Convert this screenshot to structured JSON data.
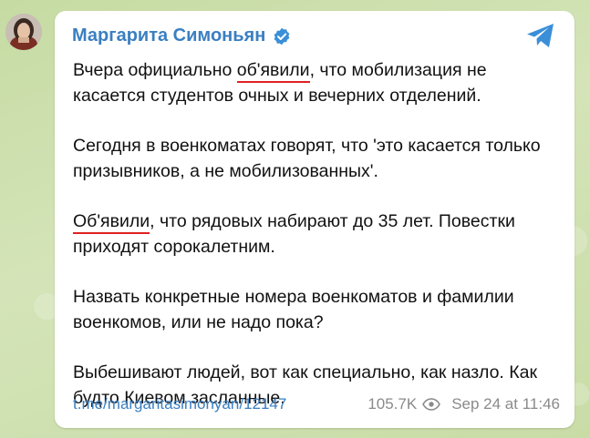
{
  "post": {
    "author": "Маргарита Симоньян",
    "paragraphs": [
      {
        "before": "Вчера официально ",
        "underlined": "об'явили",
        "after": ", что мобилизация не касается студентов очных и вечерних отделений."
      },
      {
        "text": "Сегодня в военкоматах говорят, что 'это касается только призывников, а не мобилизованных'."
      },
      {
        "underlined": "Об'явили",
        "after": ", что рядовых набирают до 35 лет. Повестки приходят сорокалетним."
      },
      {
        "text": "Назвать конкретные номера военкоматов и фамилии военкомов, или не надо пока?"
      },
      {
        "text": "Выбешивают людей, вот как специально, как назло. Как будто Киевом засланные."
      }
    ],
    "link": "t.me/margaritasimonyan/12147",
    "views": "105.7K",
    "date": "Sep 24 at 11:46"
  },
  "icons": {
    "verified": "verified-badge-icon",
    "share": "telegram-share-icon",
    "views": "eye-icon"
  },
  "colors": {
    "accent": "#3a7fc1",
    "underline": "#e02020",
    "background": "#cfe0b3"
  }
}
